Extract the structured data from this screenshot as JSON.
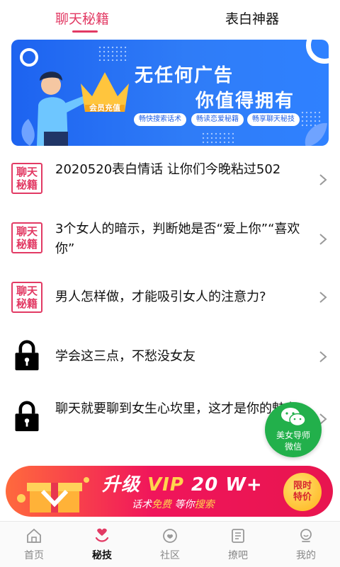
{
  "tabs": [
    {
      "label": "聊天秘籍"
    },
    {
      "label": "表白神器"
    }
  ],
  "banner": {
    "crown_label": "会员充值",
    "headline1": "无任何广告",
    "headline2": "你值得拥有",
    "pills": [
      "畅快搜索话术",
      "畅读恋爱秘籍",
      "畅享聊天秘技"
    ]
  },
  "list": {
    "stamp_text": "聊天秘籍",
    "items": [
      {
        "title": "2020520表白情话 让你们今晚粘过502",
        "locked": false
      },
      {
        "title": "3个女人的暗示，判断她是否“爱上你”“喜欢你”",
        "locked": false
      },
      {
        "title": "男人怎样做，才能吸引女人的注意力?",
        "locked": false
      },
      {
        "title": "学会这三点，不愁没女友",
        "locked": true
      },
      {
        "title": "聊天就要聊到女生心坎里，这才是你的魅力",
        "locked": true
      }
    ]
  },
  "wechat": {
    "line1": "美女导师",
    "line2": "微信"
  },
  "vip": {
    "title_prefix": "升级 ",
    "title_vip": "VIP",
    "title_suffix": " 20 W+",
    "sub_a": "话术",
    "sub_b": "免费",
    "sub_c": "  等你",
    "sub_d": "搜索",
    "badge1": "限时",
    "badge2": "特价"
  },
  "nav": [
    {
      "label": "首页",
      "icon": "home-icon"
    },
    {
      "label": "秘技",
      "icon": "heart-icon",
      "active": true
    },
    {
      "label": "社区",
      "icon": "community-icon"
    },
    {
      "label": "撩吧",
      "icon": "list-icon"
    },
    {
      "label": "我的",
      "icon": "profile-icon"
    }
  ],
  "colors": {
    "accent": "#e23a64",
    "banner_blue": "#2f7cf7",
    "wechat_green": "#22b04b"
  }
}
